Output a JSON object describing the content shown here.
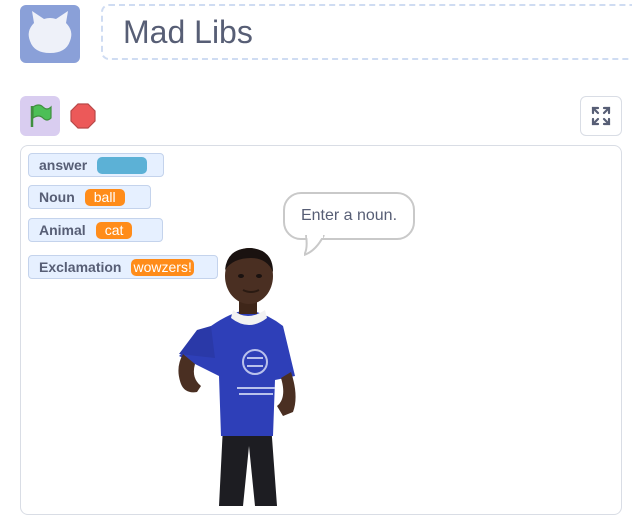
{
  "project": {
    "title": "Mad Libs"
  },
  "controls": {
    "green_flag_icon": "green-flag-icon",
    "stop_icon": "stop-sign-icon",
    "fullscreen_icon": "fullscreen-icon"
  },
  "monitors": [
    {
      "label": "answer",
      "value": ""
    },
    {
      "label": "Noun",
      "value": "ball"
    },
    {
      "label": "Animal",
      "value": "cat"
    },
    {
      "label": "Exclamation",
      "value": "wowzers!"
    }
  ],
  "speech_bubble": {
    "text": "Enter a noun."
  },
  "colors": {
    "variable_orange": "#ff8c1a",
    "answer_blue": "#5cb1d6",
    "text_gray": "#575e75"
  }
}
